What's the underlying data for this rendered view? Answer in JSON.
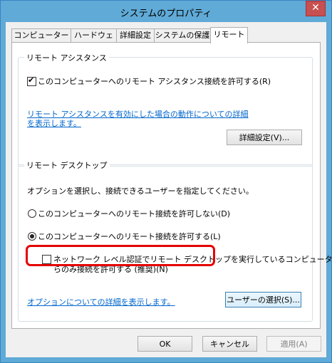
{
  "window": {
    "title": "システムのプロパティ",
    "close_label": "✕"
  },
  "tabs": [
    {
      "label": "コンピューター名"
    },
    {
      "label": "ハードウェア"
    },
    {
      "label": "詳細設定"
    },
    {
      "label": "システムの保護"
    },
    {
      "label": "リモート"
    }
  ],
  "remote_assistance": {
    "group_label": "リモート アシスタンス",
    "allow_checkbox_label": "このコンピューターへのリモート アシスタンス接続を許可する(R)",
    "allow_checked": true,
    "info_link_line1": "リモート アシスタンスを有効にした場合の動作についての詳細",
    "info_link_line2": "を表示します。",
    "advanced_button": "詳細設定(V)..."
  },
  "remote_desktop": {
    "group_label": "リモート デスクトップ",
    "instruction": "オプションを選択し、接続できるユーザーを指定してください。",
    "option_deny": "このコンピューターへのリモート接続を許可しない(D)",
    "option_allow": "このコンピューターへのリモート接続を許可する(L)",
    "selected_option": "allow",
    "nla_label_line1": "ネットワーク レベル認証でリモート デスクトップを実行しているコンピューターか",
    "nla_label_line2": "らのみ接続を許可する (推奨)(N)",
    "nla_checked": false,
    "options_link": "オプションについての詳細を表示します。",
    "select_users_button": "ユーザーの選択(S)..."
  },
  "footer": {
    "ok_button": "OK",
    "cancel_button": "キャンセル",
    "apply_button": "適用(A)"
  }
}
